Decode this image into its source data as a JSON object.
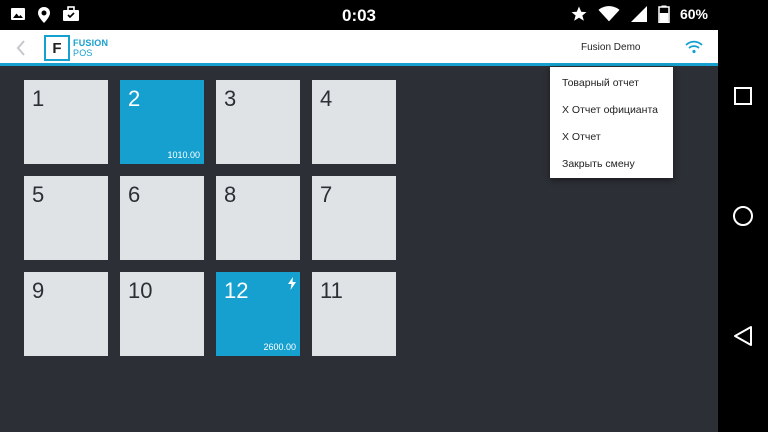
{
  "statusbar": {
    "time": "0:03",
    "battery_percent": "60%",
    "left_icons": [
      "image-icon",
      "location-pin-icon",
      "briefcase-icon"
    ],
    "right_icons": [
      "star-icon",
      "wifi-signal-icon",
      "cell-signal-icon",
      "battery-icon"
    ]
  },
  "appbar": {
    "logo_line1": "FUSION",
    "logo_line2": "POS",
    "logo_letter": "F",
    "account_name": "Fusion Demo"
  },
  "colors": {
    "accent": "#16a0cf",
    "background": "#2c2f35",
    "tile_free": "#dfe3e6",
    "tile_busy": "#16a0cf"
  },
  "tables": [
    {
      "number": "1",
      "busy": false,
      "amount": ""
    },
    {
      "number": "2",
      "busy": true,
      "amount": "1010.00"
    },
    {
      "number": "3",
      "busy": false,
      "amount": ""
    },
    {
      "number": "4",
      "busy": false,
      "amount": ""
    },
    {
      "number": "5",
      "busy": false,
      "amount": ""
    },
    {
      "number": "6",
      "busy": false,
      "amount": ""
    },
    {
      "number": "8",
      "busy": false,
      "amount": ""
    },
    {
      "number": "7",
      "busy": false,
      "amount": ""
    },
    {
      "number": "9",
      "busy": false,
      "amount": ""
    },
    {
      "number": "10",
      "busy": false,
      "amount": ""
    },
    {
      "number": "12",
      "busy": true,
      "amount": "2600.00",
      "flag": "flash-icon"
    },
    {
      "number": "11",
      "busy": false,
      "amount": ""
    }
  ],
  "menu": {
    "items": [
      "Товарный отчет",
      "X Отчет официанта",
      "X Отчет",
      "Закрыть смену"
    ]
  }
}
